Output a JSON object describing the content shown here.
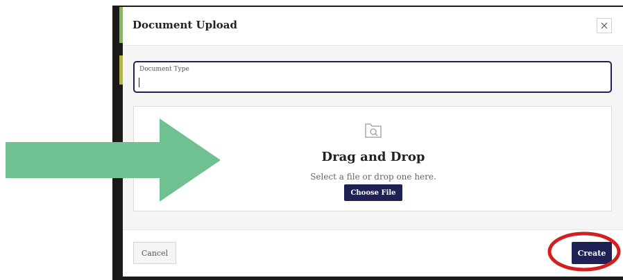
{
  "modal": {
    "title": "Document Upload"
  },
  "form": {
    "document_type_label": "Document Type",
    "document_type_value": ""
  },
  "dropzone": {
    "title": "Drag and Drop",
    "subtitle": "Select a file or drop one here.",
    "choose_file_label": "Choose File"
  },
  "footer": {
    "cancel_label": "Cancel",
    "create_label": "Create"
  },
  "icons": {
    "close": "close-icon",
    "folder": "folder-search-icon",
    "annotation_arrow": "right-arrow-annotation",
    "annotation_ring": "highlight-ellipse-annotation"
  },
  "colors": {
    "primary": "#1f2155",
    "arrow": "#6fc191",
    "highlight_ring": "#d3201f",
    "accent_green": "#8db36a",
    "accent_olive": "#b4b24a"
  }
}
